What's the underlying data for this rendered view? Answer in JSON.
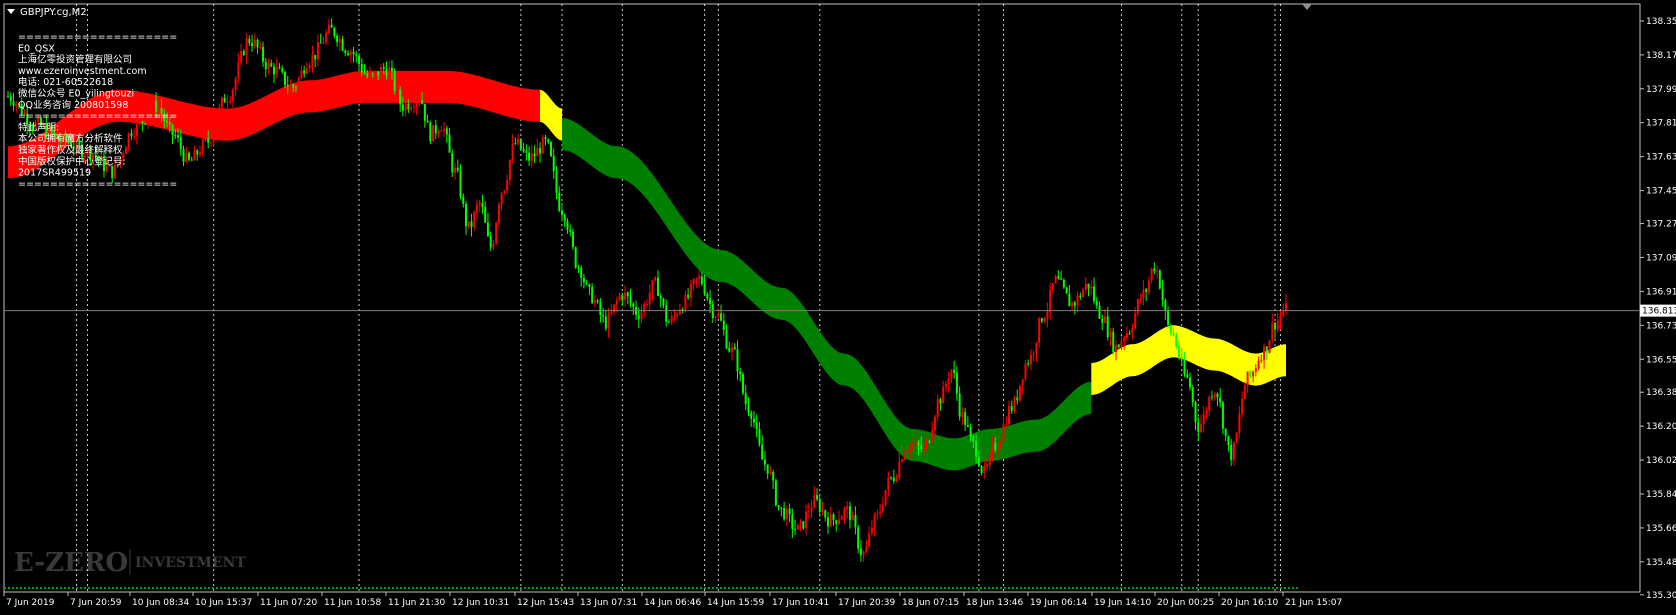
{
  "window": {
    "title": "GBPJPY.cg,M2"
  },
  "info_box": {
    "lines": [
      "====================",
      "E0_QSX",
      "上海亿零投资管理有限公司",
      "www.ezeroinvestment.com",
      "电话: 021-60522618",
      "微信公众号 E0_yilingtouzi",
      "QQ业务咨询 200801598",
      "====================",
      "特此声明:",
      "本公司拥有魔方分析软件",
      "独家著作权及最终解释权",
      "中国版权保护中心登记号:",
      "2017SR499519",
      "===================="
    ]
  },
  "watermark": {
    "text_main": "E-ZERO",
    "text_sub": "INVESTMENT"
  },
  "price_label": "136.813",
  "colors": {
    "background": "#000000",
    "bull": "#ff0000",
    "bear": "#00ff00",
    "band_red": "#ff0000",
    "band_yellow": "#ffff00",
    "band_green": "#008000",
    "grid_vline": "#ffffff",
    "price_line": "#808080"
  },
  "chart_data": {
    "type": "candlestick",
    "symbol": "GBPJPY.cg",
    "timeframe": "M2",
    "ylim": [
      135.32,
      138.44
    ],
    "y_ticks": [
      "138.350",
      "138.170",
      "137.990",
      "137.810",
      "137.630",
      "137.450",
      "137.275",
      "137.095",
      "136.915",
      "136.735",
      "136.555",
      "136.380",
      "136.200",
      "136.020",
      "135.840",
      "135.660",
      "135.480",
      "135.305"
    ],
    "x_ticks": [
      "7 Jun 2019",
      "7 Jun 20:59",
      "10 Jun 08:34",
      "10 Jun 15:37",
      "11 Jun 07:20",
      "11 Jun 10:58",
      "11 Jun 21:30",
      "12 Jun 10:31",
      "12 Jun 15:43",
      "13 Jun 07:31",
      "14 Jun 06:46",
      "14 Jun 15:59",
      "17 Jun 10:41",
      "17 Jun 20:39",
      "18 Jun 07:15",
      "18 Jun 13:46",
      "19 Jun 06:14",
      "19 Jun 14:10",
      "20 Jun 00:25",
      "20 Jun 16:10",
      "21 Jun 15:07"
    ],
    "current_price": 136.813,
    "close_path": [
      [
        0,
        137.95
      ],
      [
        10,
        137.8
      ],
      [
        20,
        137.72
      ],
      [
        30,
        137.65
      ],
      [
        38,
        137.55
      ],
      [
        46,
        137.78
      ],
      [
        54,
        137.9
      ],
      [
        60,
        137.75
      ],
      [
        66,
        137.6
      ],
      [
        72,
        137.7
      ],
      [
        80,
        137.95
      ],
      [
        88,
        138.25
      ],
      [
        96,
        138.1
      ],
      [
        104,
        138.0
      ],
      [
        110,
        138.15
      ],
      [
        118,
        138.3
      ],
      [
        124,
        138.2
      ],
      [
        132,
        138.05
      ],
      [
        138,
        138.1
      ],
      [
        144,
        137.9
      ],
      [
        150,
        137.95
      ],
      [
        154,
        137.75
      ],
      [
        158,
        137.8
      ],
      [
        163,
        137.55
      ],
      [
        168,
        137.25
      ],
      [
        172,
        137.38
      ],
      [
        176,
        137.15
      ],
      [
        180,
        137.45
      ],
      [
        185,
        137.7
      ],
      [
        190,
        137.62
      ],
      [
        196,
        137.7
      ],
      [
        202,
        137.35
      ],
      [
        208,
        137.05
      ],
      [
        212,
        136.9
      ],
      [
        218,
        136.75
      ],
      [
        224,
        136.9
      ],
      [
        230,
        136.8
      ],
      [
        236,
        136.95
      ],
      [
        241,
        136.75
      ],
      [
        246,
        136.85
      ],
      [
        252,
        136.98
      ],
      [
        258,
        136.8
      ],
      [
        264,
        136.6
      ],
      [
        270,
        136.3
      ],
      [
        276,
        136.0
      ],
      [
        282,
        135.75
      ],
      [
        288,
        135.65
      ],
      [
        294,
        135.8
      ],
      [
        300,
        135.7
      ],
      [
        306,
        135.75
      ],
      [
        312,
        135.52
      ],
      [
        316,
        135.7
      ],
      [
        322,
        135.92
      ],
      [
        328,
        136.1
      ],
      [
        334,
        136.08
      ],
      [
        340,
        136.35
      ],
      [
        344,
        136.5
      ],
      [
        348,
        136.25
      ],
      [
        352,
        136.1
      ],
      [
        356,
        135.95
      ],
      [
        360,
        136.1
      ],
      [
        366,
        136.3
      ],
      [
        372,
        136.55
      ],
      [
        378,
        136.8
      ],
      [
        382,
        136.97
      ],
      [
        388,
        136.85
      ],
      [
        394,
        136.95
      ],
      [
        398,
        136.8
      ],
      [
        404,
        136.62
      ],
      [
        408,
        136.7
      ],
      [
        414,
        136.9
      ],
      [
        418,
        137.05
      ],
      [
        424,
        136.7
      ],
      [
        430,
        136.45
      ],
      [
        434,
        136.2
      ],
      [
        440,
        136.4
      ],
      [
        446,
        136.05
      ],
      [
        452,
        136.45
      ],
      [
        458,
        136.6
      ],
      [
        462,
        136.75
      ],
      [
        466,
        136.82
      ]
    ],
    "bands": [
      {
        "color": "red",
        "from": 0,
        "to": 194,
        "path": [
          [
            0,
            137.6
          ],
          [
            40,
            137.9
          ],
          [
            80,
            137.8
          ],
          [
            110,
            137.95
          ],
          [
            130,
            138.0
          ],
          [
            160,
            138.0
          ],
          [
            194,
            137.9
          ]
        ]
      },
      {
        "color": "yellow",
        "from": 194,
        "to": 202,
        "path": [
          [
            194,
            137.9
          ],
          [
            202,
            137.8
          ]
        ]
      },
      {
        "color": "green",
        "from": 202,
        "to": 395,
        "path": [
          [
            202,
            137.75
          ],
          [
            222,
            137.6
          ],
          [
            260,
            137.05
          ],
          [
            282,
            136.85
          ],
          [
            305,
            136.5
          ],
          [
            330,
            136.1
          ],
          [
            345,
            136.05
          ],
          [
            358,
            136.1
          ],
          [
            375,
            136.15
          ],
          [
            395,
            136.35
          ]
        ]
      },
      {
        "color": "yellow",
        "from": 395,
        "to": 466,
        "path": [
          [
            395,
            136.45
          ],
          [
            410,
            136.55
          ],
          [
            425,
            136.65
          ],
          [
            440,
            136.58
          ],
          [
            455,
            136.5
          ],
          [
            466,
            136.55
          ]
        ]
      }
    ],
    "v_lines_index": [
      25,
      29,
      75,
      128,
      187,
      202,
      224,
      254,
      259,
      296,
      354,
      363,
      406,
      428,
      434,
      462,
      464
    ]
  }
}
